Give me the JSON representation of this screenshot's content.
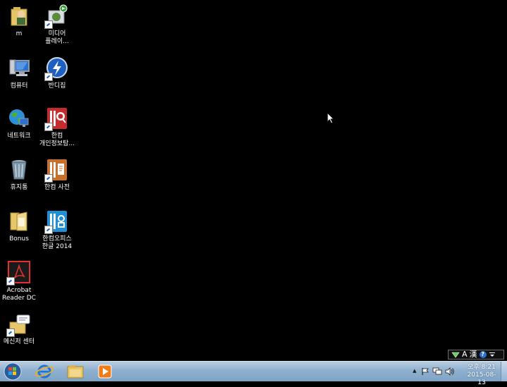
{
  "desktop": {
    "icons": [
      {
        "label": "m"
      },
      {
        "label": "미디어\n플레이..."
      },
      {
        "label": "컴퓨터"
      },
      {
        "label": "반디집"
      },
      {
        "label": "네트워크"
      },
      {
        "label": "한컴\n개인정보탐..."
      },
      {
        "label": "휴지통"
      },
      {
        "label": "한컴 사전"
      },
      {
        "label": "Bonus"
      },
      {
        "label": "한컴오피스\n한글 2014"
      },
      {
        "label": "Acrobat\nReader DC"
      },
      {
        "label": "메신저 센터"
      }
    ]
  },
  "language_bar": {
    "mode": "A",
    "hanja": "漢",
    "help": "?"
  },
  "tray": {
    "overflow": "▲",
    "time": "오후 8:21",
    "date": "2015-08-13"
  }
}
